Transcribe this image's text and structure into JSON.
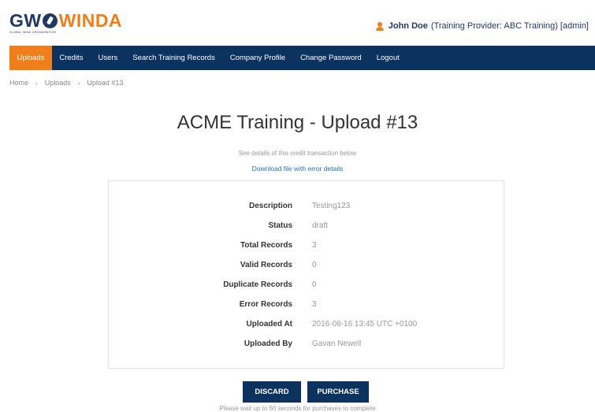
{
  "header": {
    "logo": {
      "part1": "GW",
      "part2": "WINDA",
      "subtitle": "GLOBAL WIND ORGANISATION"
    },
    "user": {
      "name": "John Doe",
      "details": "(Training Provider: ABC Training) [admin]",
      "icon": "user-icon"
    }
  },
  "nav": {
    "items": [
      {
        "label": "Uploads",
        "active": true
      },
      {
        "label": "Credits"
      },
      {
        "label": "Users"
      },
      {
        "label": "Search Training Records"
      },
      {
        "label": "Company Profile"
      },
      {
        "label": "Change Password"
      },
      {
        "label": "Logout"
      }
    ]
  },
  "breadcrumb": {
    "items": [
      "Home",
      "Uploads",
      "Upload #13"
    ],
    "separator": "›"
  },
  "page": {
    "title": "ACME Training - Upload #13",
    "subtitle": "See details of this credit transaction below",
    "download_link": "Download file with error details"
  },
  "details": {
    "rows": [
      {
        "label": "Description",
        "value": "Testing123"
      },
      {
        "label": "Status",
        "value": "draft"
      },
      {
        "label": "Total Records",
        "value": "3"
      },
      {
        "label": "Valid Records",
        "value": "0"
      },
      {
        "label": "Duplicate Records",
        "value": "0"
      },
      {
        "label": "Error Records",
        "value": "3"
      },
      {
        "label": "Uploaded At",
        "value": "2016-08-16 13:45 UTC +0100"
      },
      {
        "label": "Uploaded By",
        "value": "Gavan Newell"
      }
    ]
  },
  "actions": {
    "discard_label": "DISCARD",
    "purchase_label": "PURCHASE",
    "note": "Please wait up to 60 seconds for purchases to complete"
  },
  "colors": {
    "navy": "#0c3260",
    "orange": "#f07f1a",
    "link": "#1f6fb5"
  }
}
